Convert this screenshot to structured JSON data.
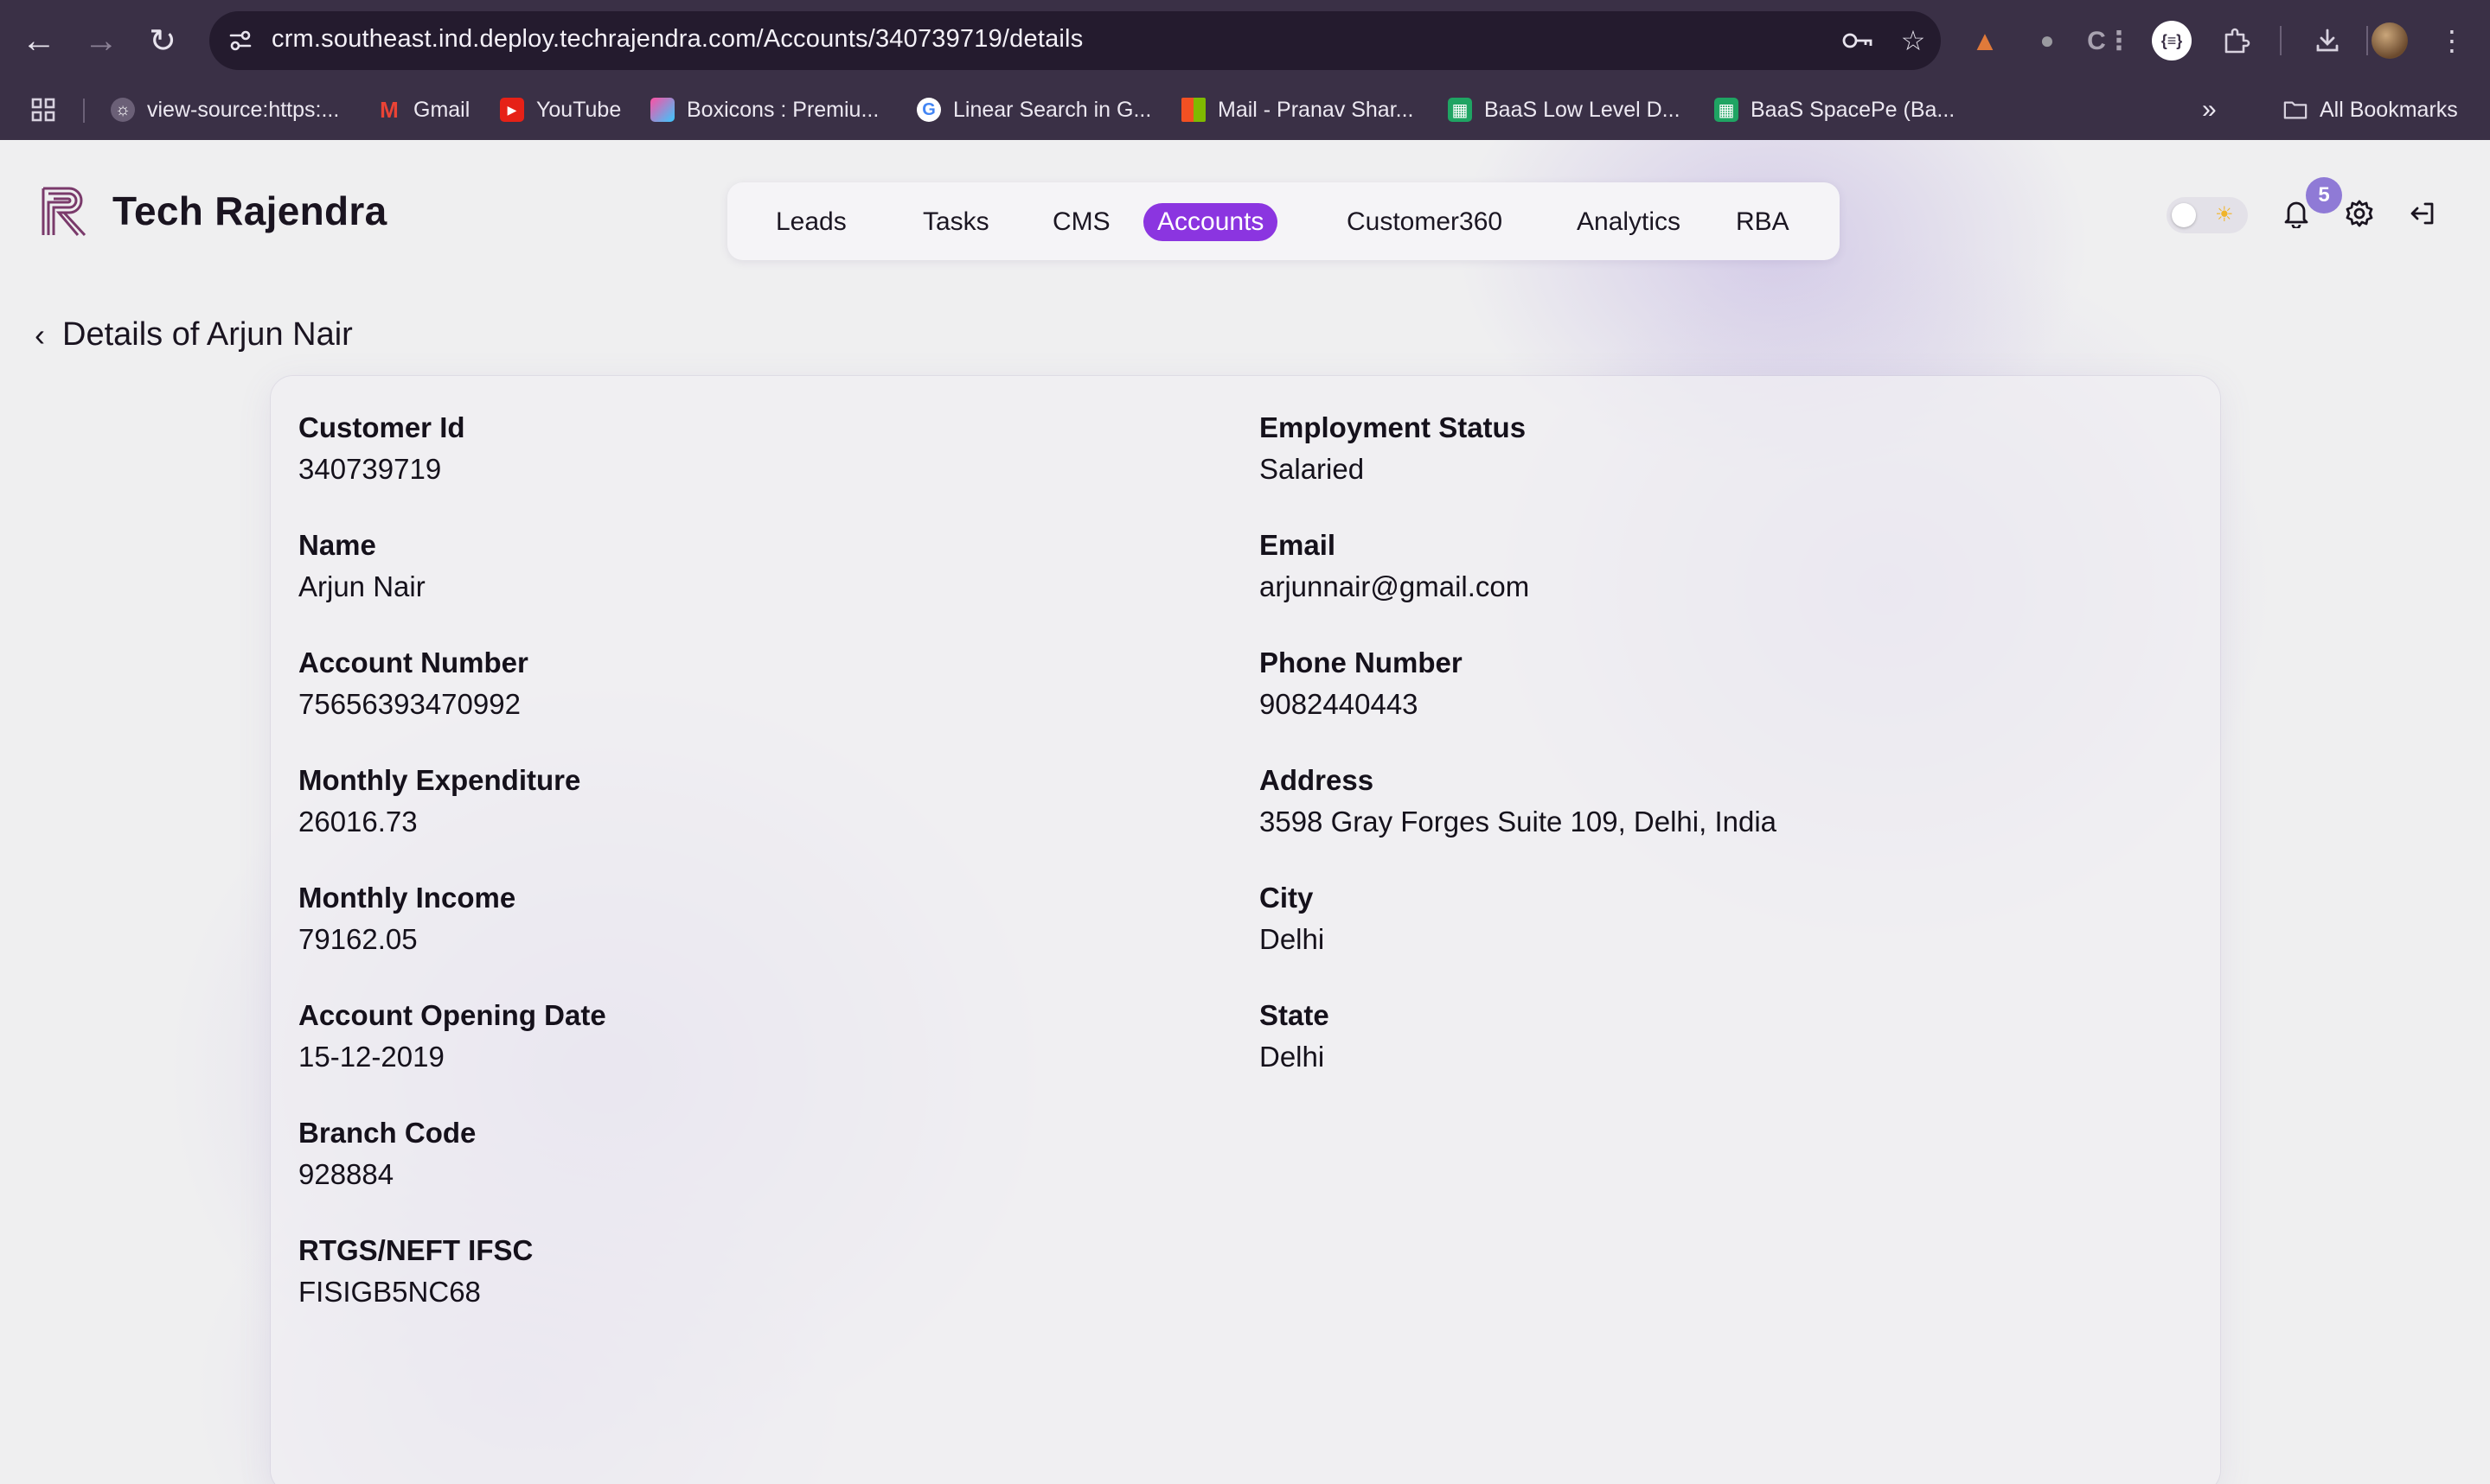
{
  "browser": {
    "url": "crm.southeast.ind.deploy.techrajendra.com/Accounts/340739719/details",
    "bookmarks": [
      {
        "label": "view-source:https:...",
        "icon": "globe-icon"
      },
      {
        "label": "Gmail",
        "icon": "gmail-icon"
      },
      {
        "label": "YouTube",
        "icon": "youtube-icon"
      },
      {
        "label": "Boxicons : Premiu...",
        "icon": "boxicons-icon"
      },
      {
        "label": "Linear Search in G...",
        "icon": "google-icon"
      },
      {
        "label": "Mail - Pranav Shar...",
        "icon": "microsoft-icon"
      },
      {
        "label": "BaaS Low Level D...",
        "icon": "sheets-icon"
      },
      {
        "label": "BaaS SpacePe (Ba...",
        "icon": "sheets-icon"
      }
    ],
    "all_bookmarks": "All Bookmarks",
    "extension_badge": "{≡}"
  },
  "app": {
    "brand": "Tech Rajendra",
    "brand_color": "#8b35e0",
    "nav": [
      {
        "label": "Leads",
        "active": false
      },
      {
        "label": "Tasks",
        "active": false
      },
      {
        "label": "CMS",
        "active": false
      },
      {
        "label": "Accounts",
        "active": true
      },
      {
        "label": "Customer360",
        "active": false
      },
      {
        "label": "Analytics",
        "active": false
      },
      {
        "label": "RBA",
        "active": false
      }
    ],
    "notifications_count": "5",
    "notification_badge_color": "#8f7ad6"
  },
  "details": {
    "title": "Details of Arjun Nair",
    "left": [
      {
        "label": "Customer Id",
        "value": "340739719"
      },
      {
        "label": "Name",
        "value": "Arjun Nair"
      },
      {
        "label": "Account Number",
        "value": "75656393470992"
      },
      {
        "label": "Monthly Expenditure",
        "value": "26016.73"
      },
      {
        "label": "Monthly Income",
        "value": "79162.05"
      },
      {
        "label": "Account Opening Date",
        "value": "15-12-2019"
      },
      {
        "label": "Branch Code",
        "value": "928884"
      },
      {
        "label": "RTGS/NEFT IFSC",
        "value": "FISIGB5NC68"
      }
    ],
    "right": [
      {
        "label": "Employment Status",
        "value": "Salaried"
      },
      {
        "label": "Email",
        "value": "arjunnair@gmail.com"
      },
      {
        "label": "Phone Number",
        "value": "9082440443"
      },
      {
        "label": "Address",
        "value": "3598 Gray Forges Suite 109, Delhi, India"
      },
      {
        "label": "City",
        "value": "Delhi"
      },
      {
        "label": "State",
        "value": "Delhi"
      }
    ]
  }
}
